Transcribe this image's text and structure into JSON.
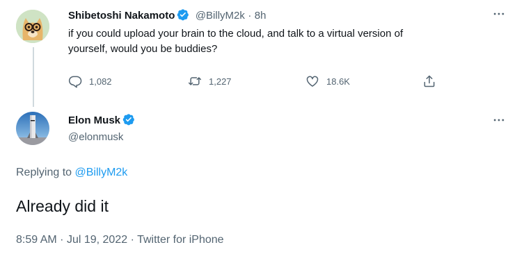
{
  "first_tweet": {
    "author_name": "Shibetoshi Nakamoto",
    "handle": "@BillyM2k",
    "separator": "·",
    "time": "8h",
    "text_line1": "if you could upload your brain to the cloud, and talk to a virtual version of",
    "text_line2": "yourself, would you be buddies?",
    "reply_count": "1,082",
    "retweet_count": "1,227",
    "like_count": "18.6K"
  },
  "second_tweet": {
    "author_name": "Elon Musk",
    "handle": "@elonmusk",
    "replying_prefix": "Replying to",
    "replying_to": "@BillyM2k",
    "text": "Already did it",
    "time": "8:59 AM",
    "dot1": "·",
    "date": "Jul 19, 2022",
    "dot2": "·",
    "source": "Twitter for iPhone"
  },
  "colors": {
    "verified": "#1d9bf0",
    "link": "#1d9bf0",
    "muted": "#536471",
    "thread_line": "#cfd9de"
  },
  "icons": [
    "doge-avatar",
    "rocket-avatar",
    "verified-badge-icon",
    "reply-icon",
    "retweet-icon",
    "like-icon",
    "share-icon",
    "more-icon"
  ]
}
